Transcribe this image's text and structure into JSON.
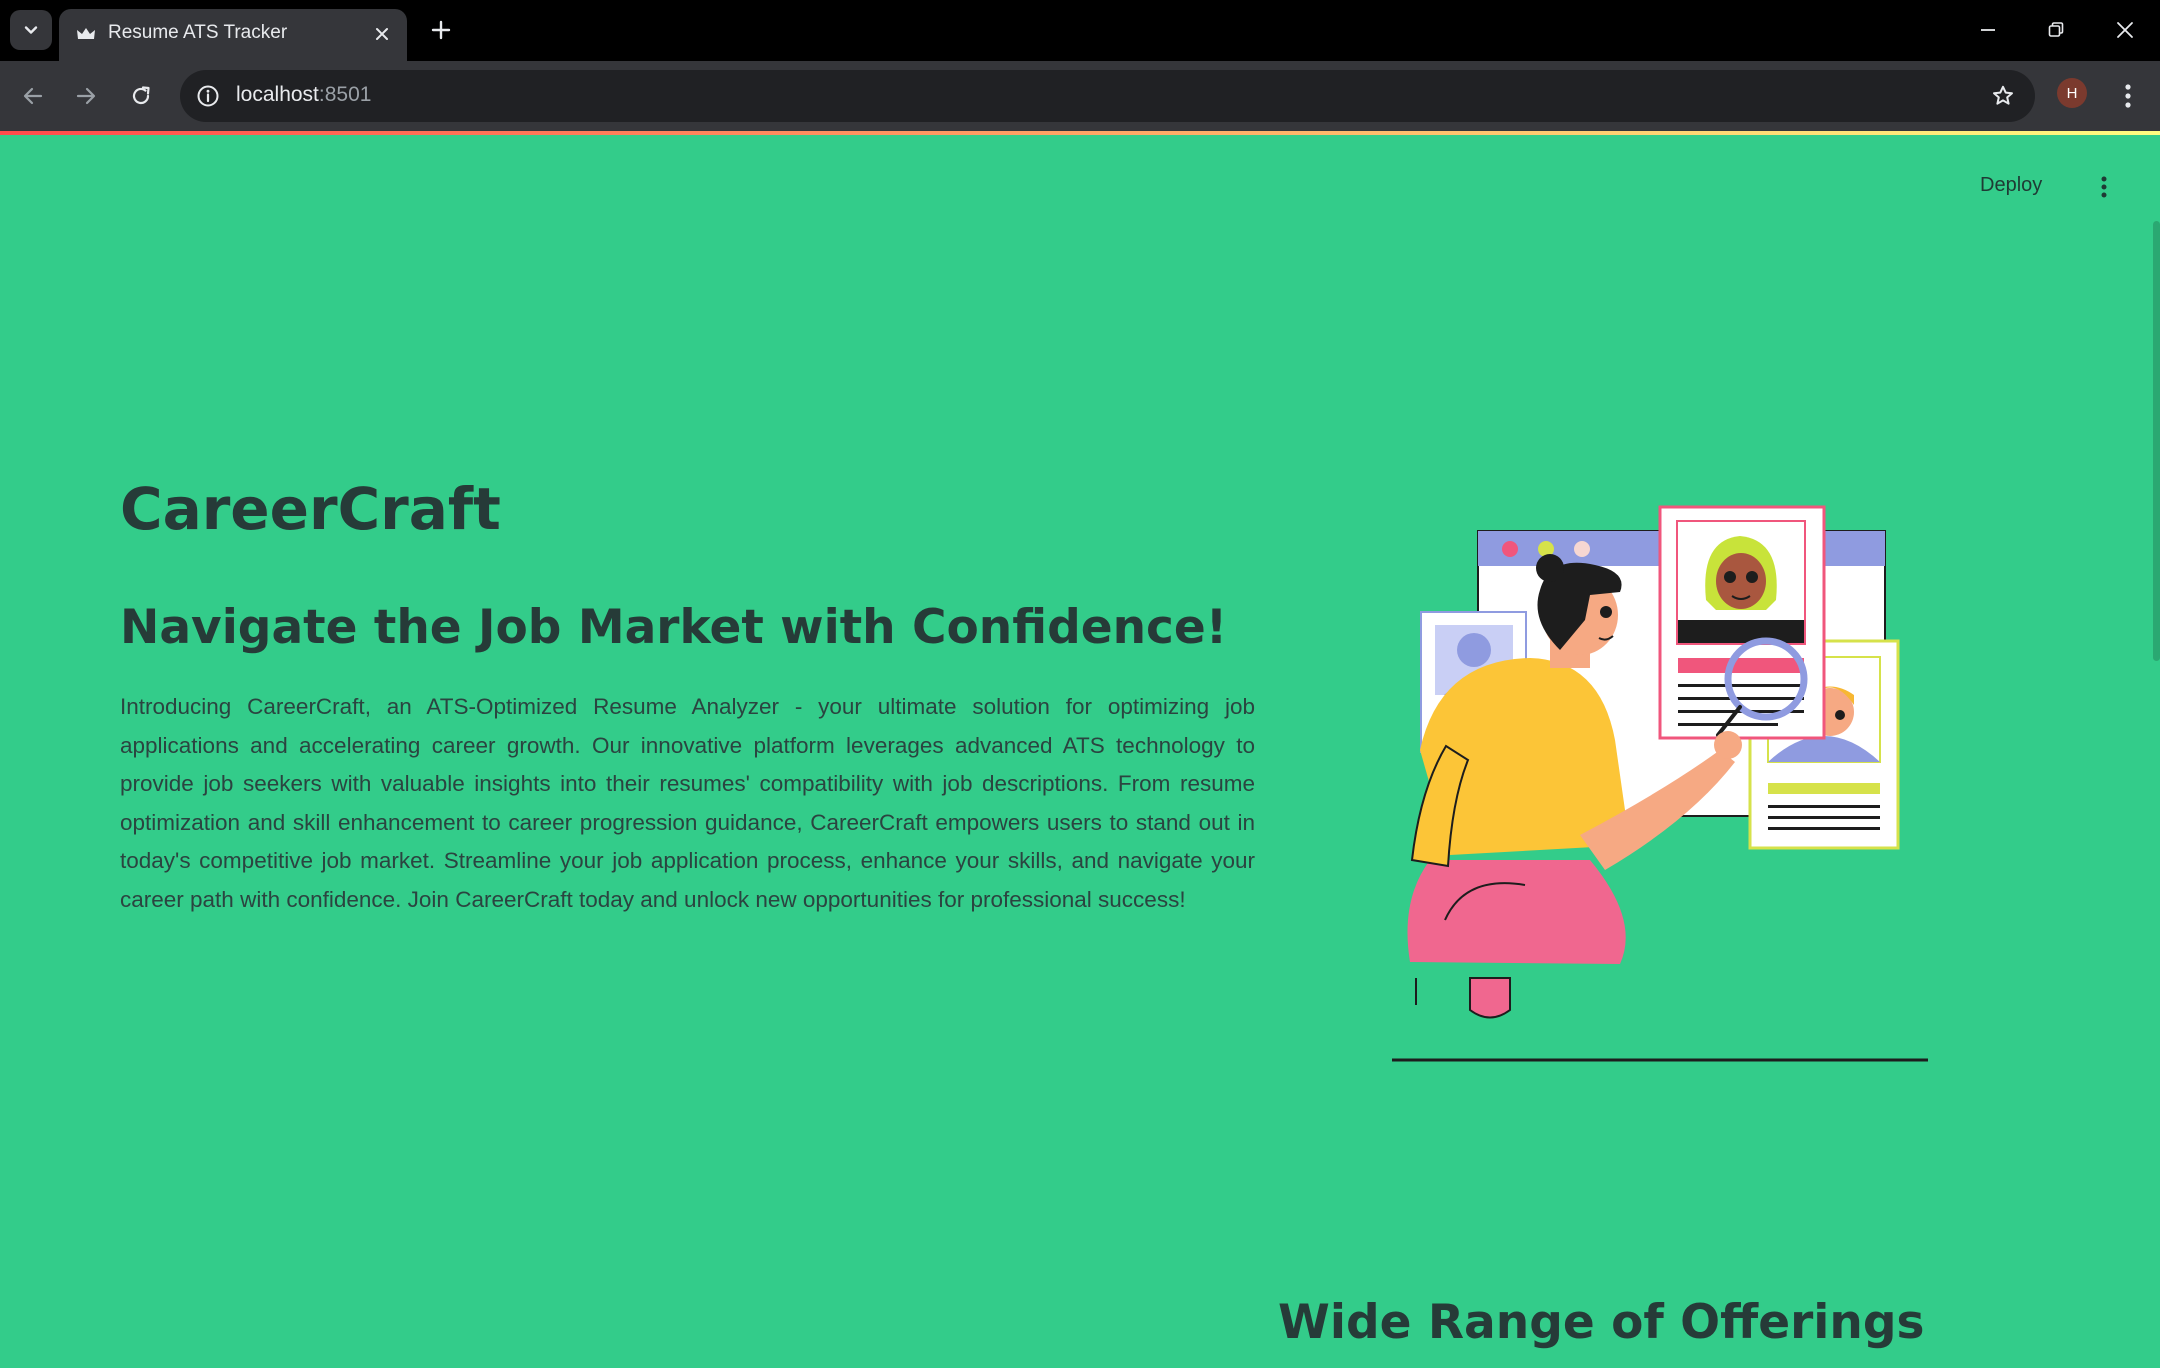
{
  "browser": {
    "tab_title": "Resume ATS Tracker",
    "url_host": "localhost",
    "url_port": ":8501",
    "profile_initial": "H"
  },
  "app": {
    "deploy_label": "Deploy",
    "hero": {
      "title": "CareerCraft",
      "subtitle": "Navigate the Job Market with Confidence!",
      "paragraph": "Introducing CareerCraft, an ATS-Optimized Resume Analyzer - your ultimate solution for optimizing job applications and accelerating career growth. Our innovative platform leverages advanced ATS technology to provide job seekers with valuable insights into their resumes' compatibility with job descriptions. From resume optimization and skill enhancement to career progression guidance, CareerCraft empowers users to stand out in today's competitive job market. Streamline your job application process, enhance your skills, and navigate your career path with confidence. Join CareerCraft today and unlock new opportunities for professional success!"
    },
    "offerings": {
      "title": "Wide Range of Offerings"
    }
  },
  "colors": {
    "app_background": "#33cc8a",
    "text_dark": "#263b38",
    "browser_dark": "#35363a",
    "omnibox": "#202124",
    "decoration_start": "#ff4b4b",
    "decoration_end": "#fffd80"
  },
  "icons": {
    "tab_search": "chevron-down-icon",
    "favicon": "crown-icon",
    "tab_close": "close-icon",
    "new_tab": "plus-icon",
    "back": "arrow-left-icon",
    "forward": "arrow-right-icon",
    "reload": "reload-icon",
    "site_info": "info-icon",
    "bookmark": "star-icon",
    "browser_menu": "kebab-menu-icon",
    "app_menu": "kebab-menu-icon"
  }
}
